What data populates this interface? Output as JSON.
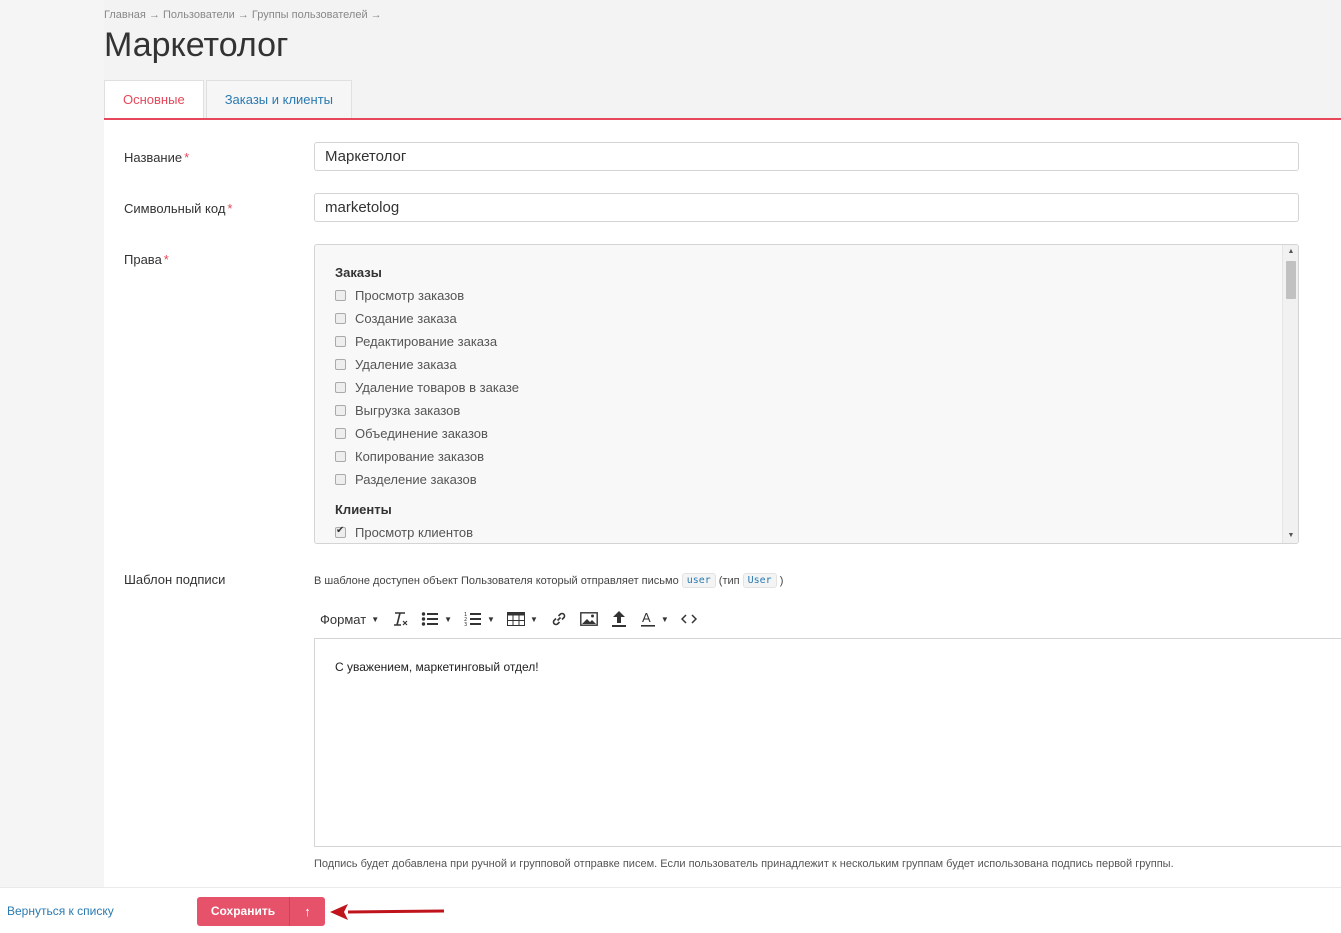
{
  "breadcrumb": {
    "items": [
      "Главная",
      "Пользователи",
      "Группы пользователей"
    ],
    "separator": "→"
  },
  "page_title": "Маркетолог",
  "tabs": [
    {
      "label": "Основные",
      "active": true
    },
    {
      "label": "Заказы и клиенты",
      "active": false
    }
  ],
  "form": {
    "name": {
      "label": "Название",
      "required_mark": "*",
      "value": "Маркетолог"
    },
    "code": {
      "label": "Символьный код",
      "required_mark": "*",
      "value": "marketolog"
    },
    "rights": {
      "label": "Права",
      "required_mark": "*",
      "groups": [
        {
          "title": "Заказы",
          "items": [
            {
              "label": "Просмотр заказов",
              "checked": false
            },
            {
              "label": "Создание заказа",
              "checked": false
            },
            {
              "label": "Редактирование заказа",
              "checked": false
            },
            {
              "label": "Удаление заказа",
              "checked": false
            },
            {
              "label": "Удаление товаров в заказе",
              "checked": false
            },
            {
              "label": "Выгрузка заказов",
              "checked": false
            },
            {
              "label": "Объединение заказов",
              "checked": false
            },
            {
              "label": "Копирование заказов",
              "checked": false
            },
            {
              "label": "Разделение заказов",
              "checked": false
            }
          ]
        },
        {
          "title": "Клиенты",
          "items": [
            {
              "label": "Просмотр клиентов",
              "checked": true
            }
          ]
        }
      ]
    },
    "signature": {
      "label": "Шаблон подписи",
      "hint_prefix": "В шаблоне доступен объект Пользователя который отправляет письмо",
      "hint_code_1": "user",
      "hint_middle": "(тип",
      "hint_code_2": "User",
      "hint_suffix": ")",
      "toolbar_format": "Формат",
      "content": "С уважением, маркетинговый отдел!",
      "note": "Подпись будет добавлена при ручной и групповой отправке писем. Если пользователь принадлежит к нескольким группам будет использована подпись первой группы."
    }
  },
  "footer": {
    "back_label": "Вернуться к списку",
    "save_label": "Сохранить",
    "save_up_icon": "↑"
  },
  "colors": {
    "accent": "#e6475a",
    "link": "#2a7ab0",
    "save_button": "#e5526a",
    "annotation_arrow": "#c0141c"
  }
}
